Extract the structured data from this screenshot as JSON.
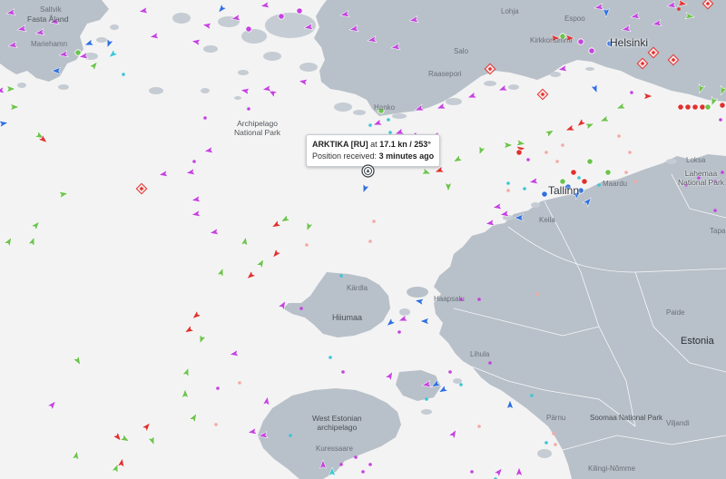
{
  "map": {
    "labels": [
      {
        "key": "fasta-aland",
        "text": "Fasta Åland"
      },
      {
        "key": "saltvik",
        "text": "Saltvik"
      },
      {
        "key": "mariehamn",
        "text": "Mariehamn"
      },
      {
        "key": "archipelago-np",
        "text": "Archipelago\nNational Park"
      },
      {
        "key": "hanko",
        "text": "Hanko"
      },
      {
        "key": "raasepori",
        "text": "Raasepori"
      },
      {
        "key": "salo",
        "text": "Salo"
      },
      {
        "key": "lohja",
        "text": "Lohja"
      },
      {
        "key": "kirkkonummi",
        "text": "Kirkkonummi"
      },
      {
        "key": "espoo",
        "text": "Espoo"
      },
      {
        "key": "helsinki",
        "text": "Helsinki"
      },
      {
        "key": "lahemaa",
        "text": "Lahemaa\nNational Park"
      },
      {
        "key": "loksa",
        "text": "Loksa"
      },
      {
        "key": "tapa",
        "text": "Tapa"
      },
      {
        "key": "tallinn",
        "text": "Tallinn"
      },
      {
        "key": "maardu",
        "text": "Maardu"
      },
      {
        "key": "keila",
        "text": "Keila"
      },
      {
        "key": "estonia",
        "text": "Estonia"
      },
      {
        "key": "paide",
        "text": "Paide"
      },
      {
        "key": "kardla",
        "text": "Kärdla"
      },
      {
        "key": "hiiumaa",
        "text": "Hiiumaa"
      },
      {
        "key": "haapsalu",
        "text": "Haapsalu"
      },
      {
        "key": "lihula",
        "text": "Lihula"
      },
      {
        "key": "west-estonian-archipelago",
        "text": "West Estonian\narchipelago"
      },
      {
        "key": "kuressaare",
        "text": "Kuressaare"
      },
      {
        "key": "parnu",
        "text": "Pärnu"
      },
      {
        "key": "soomaa-np",
        "text": "Soomaa National Park"
      },
      {
        "key": "viljandi",
        "text": "Viljandi"
      },
      {
        "key": "kilingi-nomme",
        "text": "Kilingi-Nõmme"
      }
    ],
    "vessel_colors": {
      "cargo": "#6dc34d",
      "tanker": "#e0312f",
      "passenger": "#2f6fe0",
      "pleasure": "#c542e0",
      "fishing": "#f4a9a3",
      "special": "#3ac6d6"
    },
    "selected_vessel": {
      "name": "ARKTIKA [RU]",
      "at_label": "at",
      "speed": "17.1 kn",
      "separator": "/",
      "course": "253°",
      "position_label": "Position received:",
      "position_age": "3 minutes ago",
      "icon": "target-ring-icon"
    }
  }
}
